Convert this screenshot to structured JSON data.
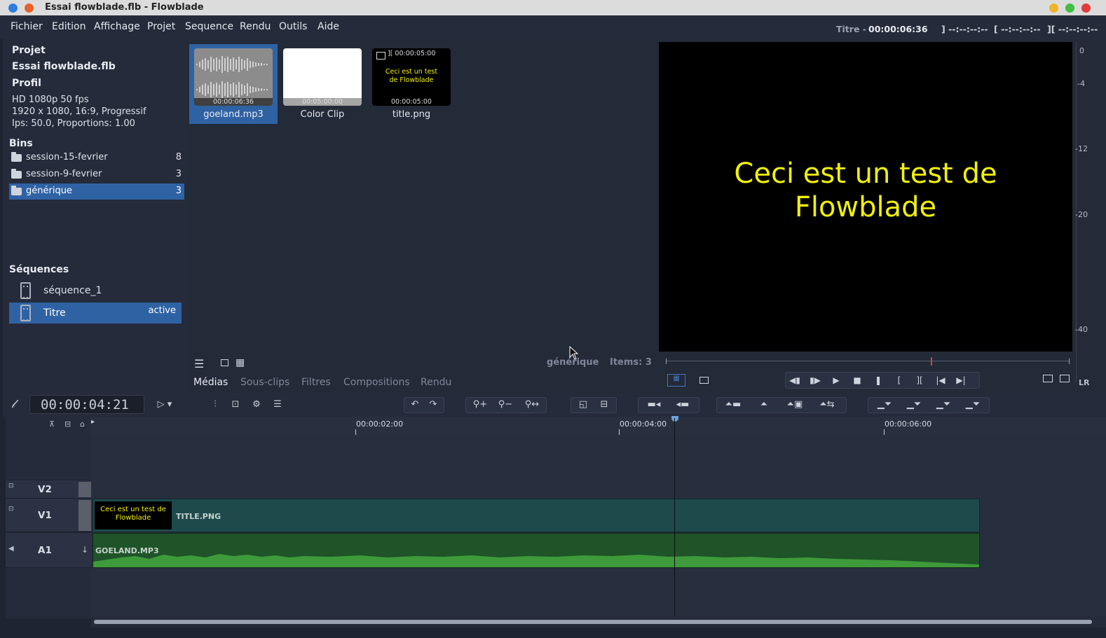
{
  "window": {
    "title": "Essai flowblade.flb - Flowblade"
  },
  "menu": [
    "Fichier",
    "Edition",
    "Affichage",
    "Projet",
    "Sequence",
    "Rendu",
    "Outils",
    "Aide"
  ],
  "header_tc": {
    "seq_label": "Titre -",
    "seq_time": "00:00:06:36",
    "mark_out": "] --:--:--:--",
    "mark_in": "[ --:--:--:--",
    "length": "][ --:--:--:--"
  },
  "project": {
    "heading": "Projet",
    "name": "Essai flowblade.flb",
    "profile_heading": "Profil",
    "profile_name": "HD 1080p 50 fps",
    "profile_res": "1920 x 1080, 16:9, Progressif",
    "profile_fps": "Ips: 50.0, Proportions: 1.00"
  },
  "bins": {
    "heading": "Bins",
    "items": [
      {
        "name": "session-15-fevrier",
        "count": "8"
      },
      {
        "name": "session-9-fevrier",
        "count": "3"
      },
      {
        "name": "générique",
        "count": "3"
      }
    ]
  },
  "sequences": {
    "heading": "Séquences",
    "items": [
      {
        "name": "séquence_1",
        "status": ""
      },
      {
        "name": "Titre",
        "status": "active"
      }
    ]
  },
  "media": {
    "items": [
      {
        "name": "goeland.mp3",
        "duration": "00:00:06:36"
      },
      {
        "name": "Color Clip",
        "duration": "00:05:00:00"
      },
      {
        "name": "title.png",
        "duration": "00:00:05:00",
        "duration_top": "][ 00:00:05:00",
        "preview_text": "Ceci est un test de Flowblade"
      }
    ],
    "bin_name": "générique",
    "items_count": "Items: 3",
    "tabs": [
      "Médias",
      "Sous-clips",
      "Filtres",
      "Compositions",
      "Rendu"
    ]
  },
  "monitor": {
    "line1": "Ceci est un test de",
    "line2": "Flowblade",
    "db_scale": [
      "0",
      "-4",
      "-12",
      "-20",
      "-40"
    ],
    "lr": "LR"
  },
  "timeline": {
    "timecode": "00:00:04:21",
    "ruler_labels": [
      "00:00:02:00",
      "00:00:04:00",
      "00:00:06:00"
    ],
    "tracks": [
      "V2",
      "V1",
      "A1"
    ],
    "clips": {
      "title_label": "TITLE.PNG",
      "title_thumb_text": "Ceci est un test de Flowblade",
      "audio_label": "GOELAND.MP3"
    }
  }
}
